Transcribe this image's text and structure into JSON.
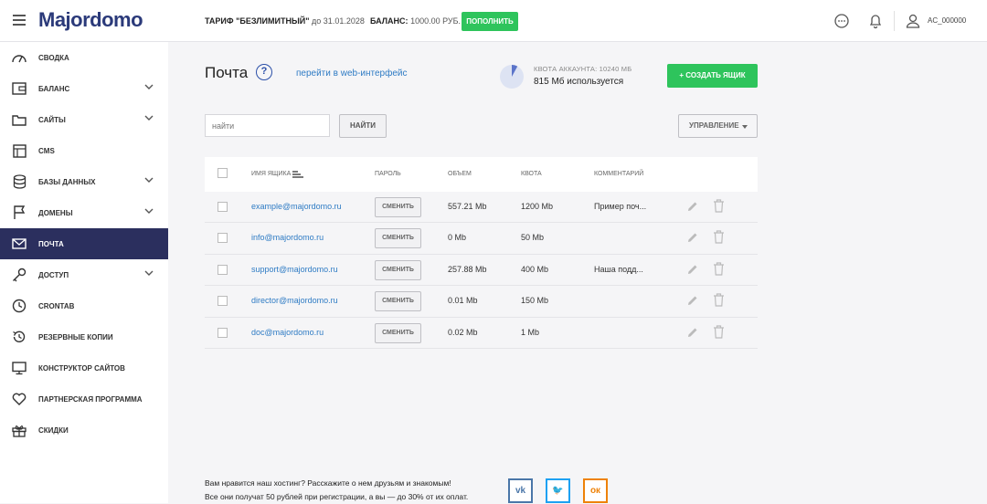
{
  "header": {
    "logo": "Majordomo",
    "tariff_label": "ТАРИФ \"БЕЗЛИМИТНЫЙ\"",
    "tariff_date": "до 31.01.2028",
    "balance_label": "БАЛАНС:",
    "balance_value": "1000.00 РУБ.",
    "topup_button": "ПОПОЛНИТЬ",
    "user": "AC_000000"
  },
  "sidebar": {
    "items": [
      {
        "label": "СВОДКА",
        "icon": "dashboard-icon"
      },
      {
        "label": "БАЛАНС",
        "icon": "wallet-icon",
        "expandable": true
      },
      {
        "label": "САЙТЫ",
        "icon": "folder-icon",
        "expandable": true
      },
      {
        "label": "CMS",
        "icon": "layout-icon"
      },
      {
        "label": "БАЗЫ ДАННЫХ",
        "icon": "database-icon",
        "expandable": true
      },
      {
        "label": "ДОМЕНЫ",
        "icon": "flag-icon",
        "expandable": true
      },
      {
        "label": "ПОЧТА",
        "icon": "mail-icon",
        "active": true
      },
      {
        "label": "ДОСТУП",
        "icon": "key-icon",
        "expandable": true
      },
      {
        "label": "CRONTAB",
        "icon": "clock-icon"
      },
      {
        "label": "РЕЗЕРВНЫЕ КОПИИ",
        "icon": "history-icon"
      },
      {
        "label": "КОНСТРУКТОР САЙТОВ",
        "icon": "monitor-icon"
      },
      {
        "label": "ПАРТНЕРСКАЯ ПРОГРАММА",
        "icon": "heart-icon"
      },
      {
        "label": "СКИДКИ",
        "icon": "gift-icon"
      }
    ]
  },
  "main": {
    "title": "Почта",
    "help": "?",
    "web_link": "перейти в web-интерфейс",
    "quota_label": "КВОТА АККАУНТА: 10240 МБ",
    "quota_used": "815 Мб используется",
    "quota_fraction": 0.0796,
    "create_button": "+ СОЗДАТЬ ЯЩИК",
    "search_placeholder": "найти",
    "search_button": "НАЙТИ",
    "manage_button": "УПРАВЛЕНИЕ"
  },
  "table": {
    "columns": [
      "ИМЯ ЯЩИКА",
      "ПАРОЛЬ",
      "ОБЪЕМ",
      "КВОТА",
      "КОММЕНТАРИЙ"
    ],
    "change_label": "СМЕНИТЬ",
    "rows": [
      {
        "name": "example@majordomo.ru",
        "volume": "557.21 Mb",
        "quota": "1200 Mb",
        "comment": "Пример поч..."
      },
      {
        "name": "info@majordomo.ru",
        "volume": "0 Mb",
        "quota": "50 Mb",
        "comment": ""
      },
      {
        "name": "support@majordomo.ru",
        "volume": "257.88 Mb",
        "quota": "400 Mb",
        "comment": "Наша подд..."
      },
      {
        "name": "director@majordomo.ru",
        "volume": "0.01 Mb",
        "quota": "150 Mb",
        "comment": ""
      },
      {
        "name": "doc@majordomo.ru",
        "volume": "0.02 Mb",
        "quota": "1 Mb",
        "comment": ""
      }
    ]
  },
  "footer": {
    "line1": "Вам нравится наш хостинг? Расскажите о нем друзьям и знакомым!",
    "line2": "Все они получат 50 рублей при регистрации, а вы — до 30% от их оплат.",
    "social": [
      {
        "name": "vk",
        "label": "vk",
        "color": "#4a76a8"
      },
      {
        "name": "twitter",
        "label": "🐦",
        "color": "#1da1f2"
      },
      {
        "name": "odnoklassniki",
        "label": "ок",
        "color": "#ee8208"
      }
    ]
  },
  "colors": {
    "accent_green": "#2ec45c",
    "active_nav": "#2b2f5e",
    "link_blue": "#2e7bc4"
  }
}
